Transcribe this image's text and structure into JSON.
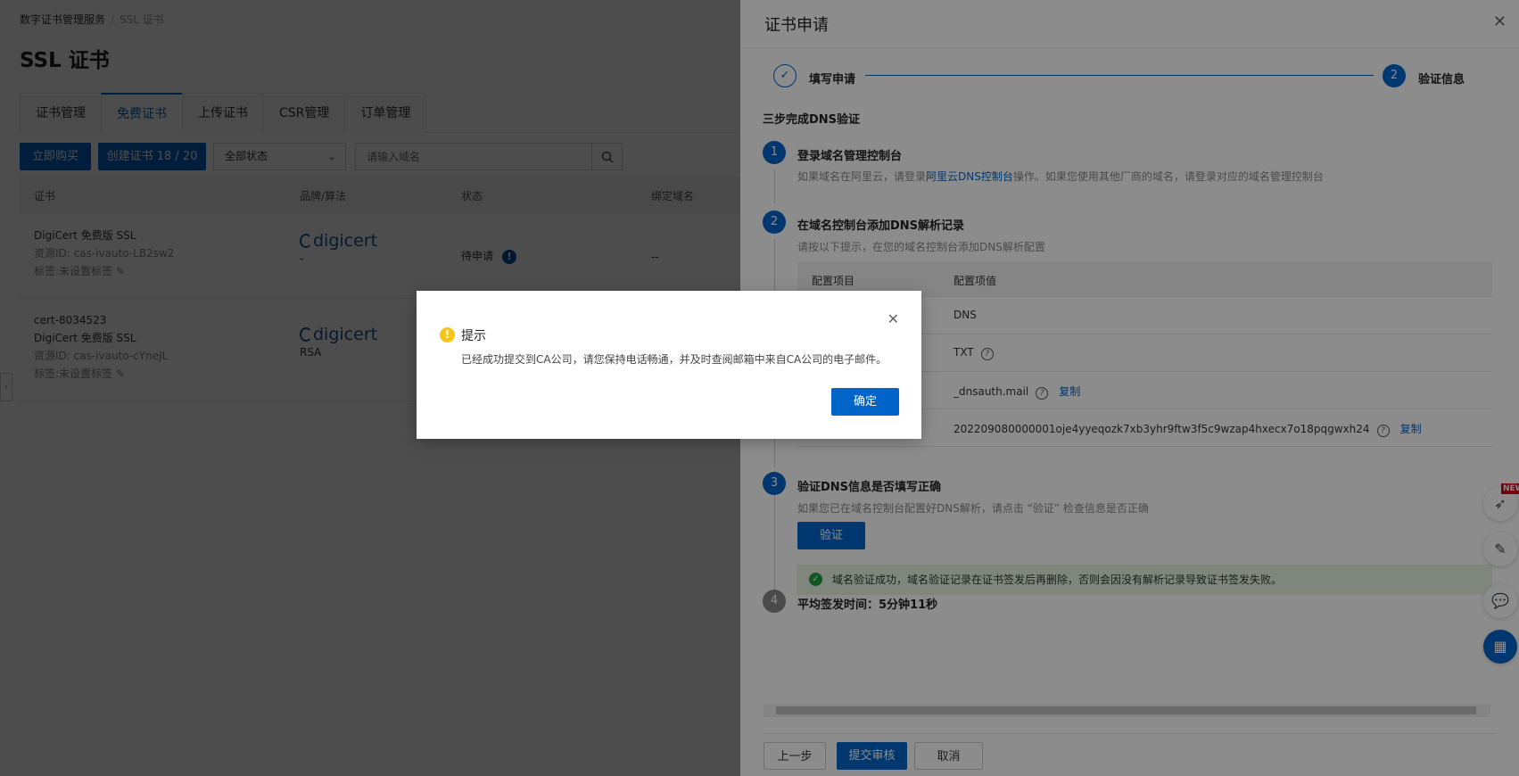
{
  "breadcrumb": {
    "root": "数字证书管理服务",
    "sep": "/",
    "current": "SSL 证书"
  },
  "page_title": "SSL 证书",
  "tabs": [
    "证书管理",
    "免费证书",
    "上传证书",
    "CSR管理",
    "订单管理"
  ],
  "toolbar": {
    "buy": "立即购买",
    "create": "创建证书 18 / 20",
    "status_select": "全部状态",
    "search_placeholder": "请输入域名"
  },
  "table": {
    "headers": [
      "证书",
      "品牌/算法",
      "状态",
      "绑定域名"
    ],
    "rows": [
      {
        "name": "",
        "type": "DigiCert 免费版 SSL",
        "resource": "资源ID: cas-ivauto-LB2sw2",
        "tag": "标签:未设置标签",
        "brand": "digicert",
        "algo": "-",
        "status": "待申请",
        "domain": "--"
      },
      {
        "name": "cert-8034523",
        "type": "DigiCert 免费版 SSL",
        "resource": "资源ID: cas-ivauto-cYneJL",
        "tag": "标签:未设置标签",
        "brand": "digicert",
        "algo": "RSA"
      }
    ]
  },
  "drawer": {
    "title": "证书申请",
    "steps": [
      {
        "num": "✓",
        "label": "填写申请"
      },
      {
        "num": "2",
        "label": "验证信息"
      }
    ],
    "heading": "三步完成DNS验证",
    "step1": {
      "num": "1",
      "title": "登录域名管理控制台",
      "desc_pre": "如果域名在阿里云，请登录",
      "desc_link": "阿里云DNS控制台",
      "desc_post": "操作。如果您使用其他厂商的域名，请登录对应的域名管理控制台"
    },
    "step2": {
      "num": "2",
      "title": "在域名控制台添加DNS解析记录",
      "desc": "请按以下提示，在您的域名控制台添加DNS解析配置",
      "headers": [
        "配置项目",
        "配置项值"
      ],
      "rows": [
        {
          "value": "DNS"
        },
        {
          "value": "TXT",
          "help": "?"
        },
        {
          "value": "_dnsauth.mail",
          "help": "?",
          "copy": "复制"
        },
        {
          "value": "202209080000001oje4yyeqozk7xb3yhr9ftw3f5c9wzap4hxecx7o18pqgwxh24",
          "help": "?",
          "copy": "复制"
        }
      ]
    },
    "step3": {
      "num": "3",
      "title": "验证DNS信息是否填写正确",
      "desc": "如果您已在域名控制台配置好DNS解析，请点击 “验证” 检查信息是否正确",
      "button": "验证",
      "success": "域名验证成功，域名验证记录在证书签发后再删除，否则会因没有解析记录导致证书签发失败。"
    },
    "step4": {
      "num": "4",
      "title": "平均签发时间：5分钟11秒"
    },
    "footer": {
      "prev": "上一步",
      "submit": "提交审核",
      "cancel": "取消"
    }
  },
  "float_badge": "NEW",
  "modal": {
    "title": "提示",
    "message": "已经成功提交到CA公司，请您保持电话畅通，并及时查阅邮箱中来自CA公司的电子邮件。",
    "ok": "确定"
  },
  "colors": {
    "primary": "#0064c8",
    "success": "#1e9e3e",
    "warning": "#f5c518"
  }
}
